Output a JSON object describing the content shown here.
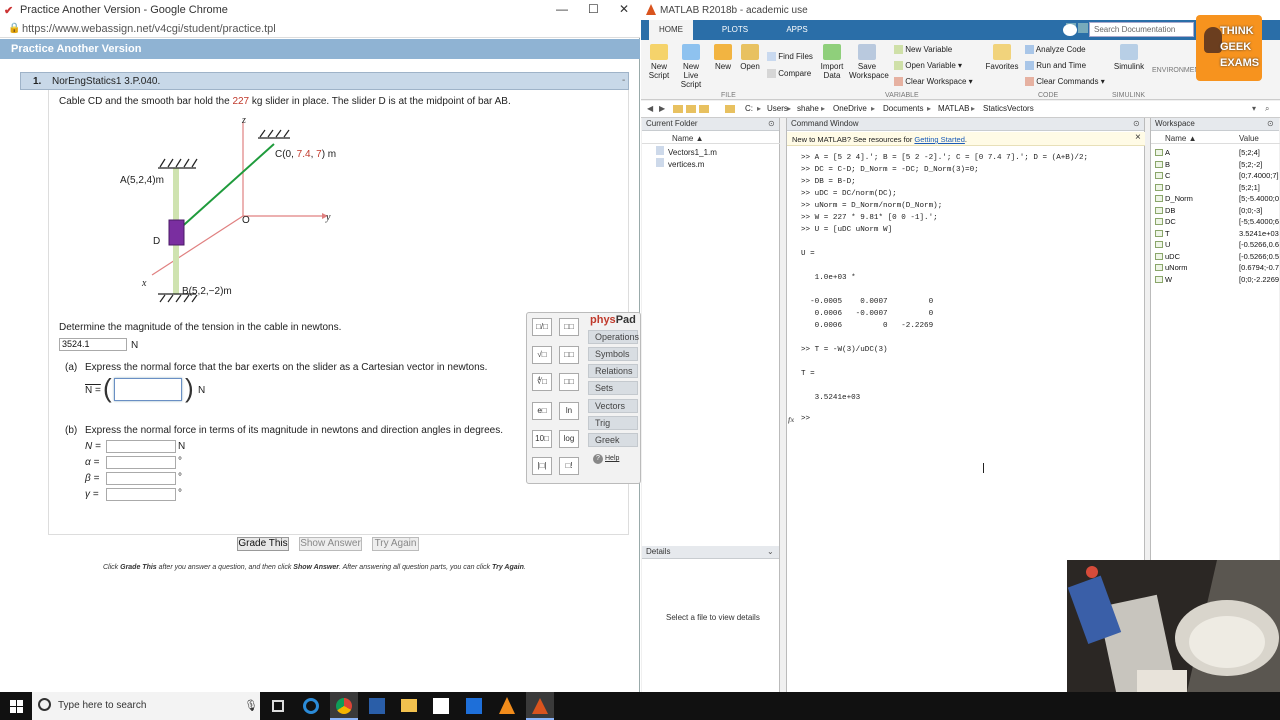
{
  "chrome": {
    "title": "Practice Another Version - Google Chrome",
    "url": "https://www.webassign.net/v4cgi/student/practice.tpl",
    "controls": {
      "minimize": "—",
      "maximize": "☐",
      "close": "✕"
    }
  },
  "webassign": {
    "header": "Practice Another Version",
    "question_number": "1.",
    "question_code": "NorEngStatics1 3.P.040.",
    "collapse": "-",
    "intro_pre": "Cable CD and the smooth bar hold the ",
    "mass": "227",
    "intro_post": " kg slider in place. The slider D is at the midpoint of bar AB.",
    "figure": {
      "z": "z",
      "y": "y",
      "x": "x",
      "o": "O",
      "d": "D",
      "a_label": "A(5,2,4)m",
      "b_label": "B(5,2,−2)m",
      "c_pre": "C(0, ",
      "c_y": "7.4",
      "c_sep": ", ",
      "c_z": "7",
      "c_post": ") m"
    },
    "tension_prompt": "Determine the magnitude of the tension in the cable in newtons.",
    "tension_value": "3524.1",
    "unit_n": "N",
    "part_a_label": "(a)",
    "part_a_text": "Express the normal force that the bar exerts on the slider as a Cartesian vector in newtons.",
    "part_a_symbol": "N =",
    "part_b_label": "(b)",
    "part_b_text": "Express the normal force in terms of its magnitude in newtons and direction angles in degrees.",
    "part_b_fields": [
      {
        "sym": "N =",
        "unit": "N"
      },
      {
        "sym": "α =",
        "unit": "°"
      },
      {
        "sym": "β =",
        "unit": "°"
      },
      {
        "sym": "γ =",
        "unit": "°"
      }
    ],
    "buttons": {
      "grade": "Grade This",
      "show": "Show Answer",
      "try": "Try Again"
    },
    "instruction_1": "Click ",
    "instruction_grade": "Grade This",
    "instruction_2": " after you answer a question, and then click ",
    "instruction_show": "Show Answer",
    "instruction_3": ". After answering all question parts, you can click ",
    "instruction_try": "Try Again",
    "instruction_4": "."
  },
  "physpad": {
    "brand_a": "phys",
    "brand_b": "Pad",
    "tabs": [
      "Operations",
      "Symbols",
      "Relations",
      "Sets",
      "Vectors",
      "Trig",
      "Greek"
    ],
    "help": "Help",
    "keys": [
      "□/□",
      "□□",
      "√□",
      "□□",
      "∜□",
      "□□",
      "e□",
      "ln",
      "10□",
      "log",
      "|□|",
      "□!"
    ]
  },
  "matlab": {
    "title": "MATLAB R2018b - academic use",
    "tabs": [
      "HOME",
      "PLOTS",
      "APPS"
    ],
    "search_placeholder": "Search Documentation",
    "ribbon": {
      "new_script": "New Script",
      "new_live_script": "New Live Script",
      "new": "New",
      "open": "Open",
      "find_files": "Find Files",
      "compare": "Compare",
      "import_data": "Import Data",
      "save_workspace": "Save Workspace",
      "new_variable": "New Variable",
      "open_variable": "Open Variable ▾",
      "clear_workspace": "Clear Workspace ▾",
      "favorites": "Favorites",
      "analyze_code": "Analyze Code",
      "run_and_time": "Run and Time",
      "clear_commands": "Clear Commands ▾",
      "simulink": "Simulink",
      "environment": "ENVIRONMENT",
      "sec_file": "FILE",
      "sec_variable": "VARIABLE",
      "sec_code": "CODE",
      "sec_simulink": "SIMULINK"
    },
    "path": [
      "C:",
      "Users",
      "shahe",
      "OneDrive",
      "Documents",
      "MATLAB",
      "StaticsVectors"
    ],
    "current_folder": {
      "title": "Current Folder",
      "col_name": "Name ▲",
      "files": [
        "Vectors1_1.m",
        "vertices.m"
      ]
    },
    "details": {
      "title": "Details",
      "message": "Select a file to view details"
    },
    "command_window": {
      "title": "Command Window",
      "banner_pre": "New to MATLAB? See resources for ",
      "banner_link": "Getting Started",
      "banner_post": ".",
      "prompt": ">>",
      "fx": "fx",
      "lines": [
        ">> A = [5 2 4].'; B = [5 2 -2].'; C = [0 7.4 7].'; D = (A+B)/2;",
        ">> DC = C-D; D_Norm = -DC; D_Norm(3)=0;",
        ">> DB = B-D;",
        ">> uDC = DC/norm(DC);",
        ">> uNorm = D_Norm/norm(D_Norm);",
        ">> W = 227 * 9.81* [0 0 -1].';",
        ">> U = [uDC uNorm W]",
        "",
        "U =",
        "",
        "   1.0e+03 *",
        "",
        "  -0.0005    0.0007         0",
        "   0.0006   -0.0007         0",
        "   0.0006         0   -2.2269",
        "",
        ">> T = -W(3)/uDC(3)",
        "",
        "T =",
        "",
        "   3.5241e+03"
      ]
    },
    "workspace": {
      "title": "Workspace",
      "col_name": "Name ▲",
      "col_value": "Value",
      "vars": [
        {
          "name": "A",
          "value": "[5;2;4]"
        },
        {
          "name": "B",
          "value": "[5;2;-2]"
        },
        {
          "name": "C",
          "value": "[0;7.4000;7]"
        },
        {
          "name": "D",
          "value": "[5;2;1]"
        },
        {
          "name": "D_Norm",
          "value": "[5;-5.4000;0]"
        },
        {
          "name": "DB",
          "value": "[0;0;-3]"
        },
        {
          "name": "DC",
          "value": "[-5;5.4000;6]"
        },
        {
          "name": "T",
          "value": "3.5241e+03"
        },
        {
          "name": "U",
          "value": "[-0.5266,0.6]"
        },
        {
          "name": "uDC",
          "value": "[-0.5266;0.5]"
        },
        {
          "name": "uNorm",
          "value": "[0.6794;-0.7]"
        },
        {
          "name": "W",
          "value": "[0;0;-2.2269]"
        }
      ]
    }
  },
  "watermark": {
    "line1": "THINK",
    "line2": "GEEK",
    "line3": "EXAMS"
  },
  "taskbar": {
    "search_placeholder": "Type here to search"
  }
}
